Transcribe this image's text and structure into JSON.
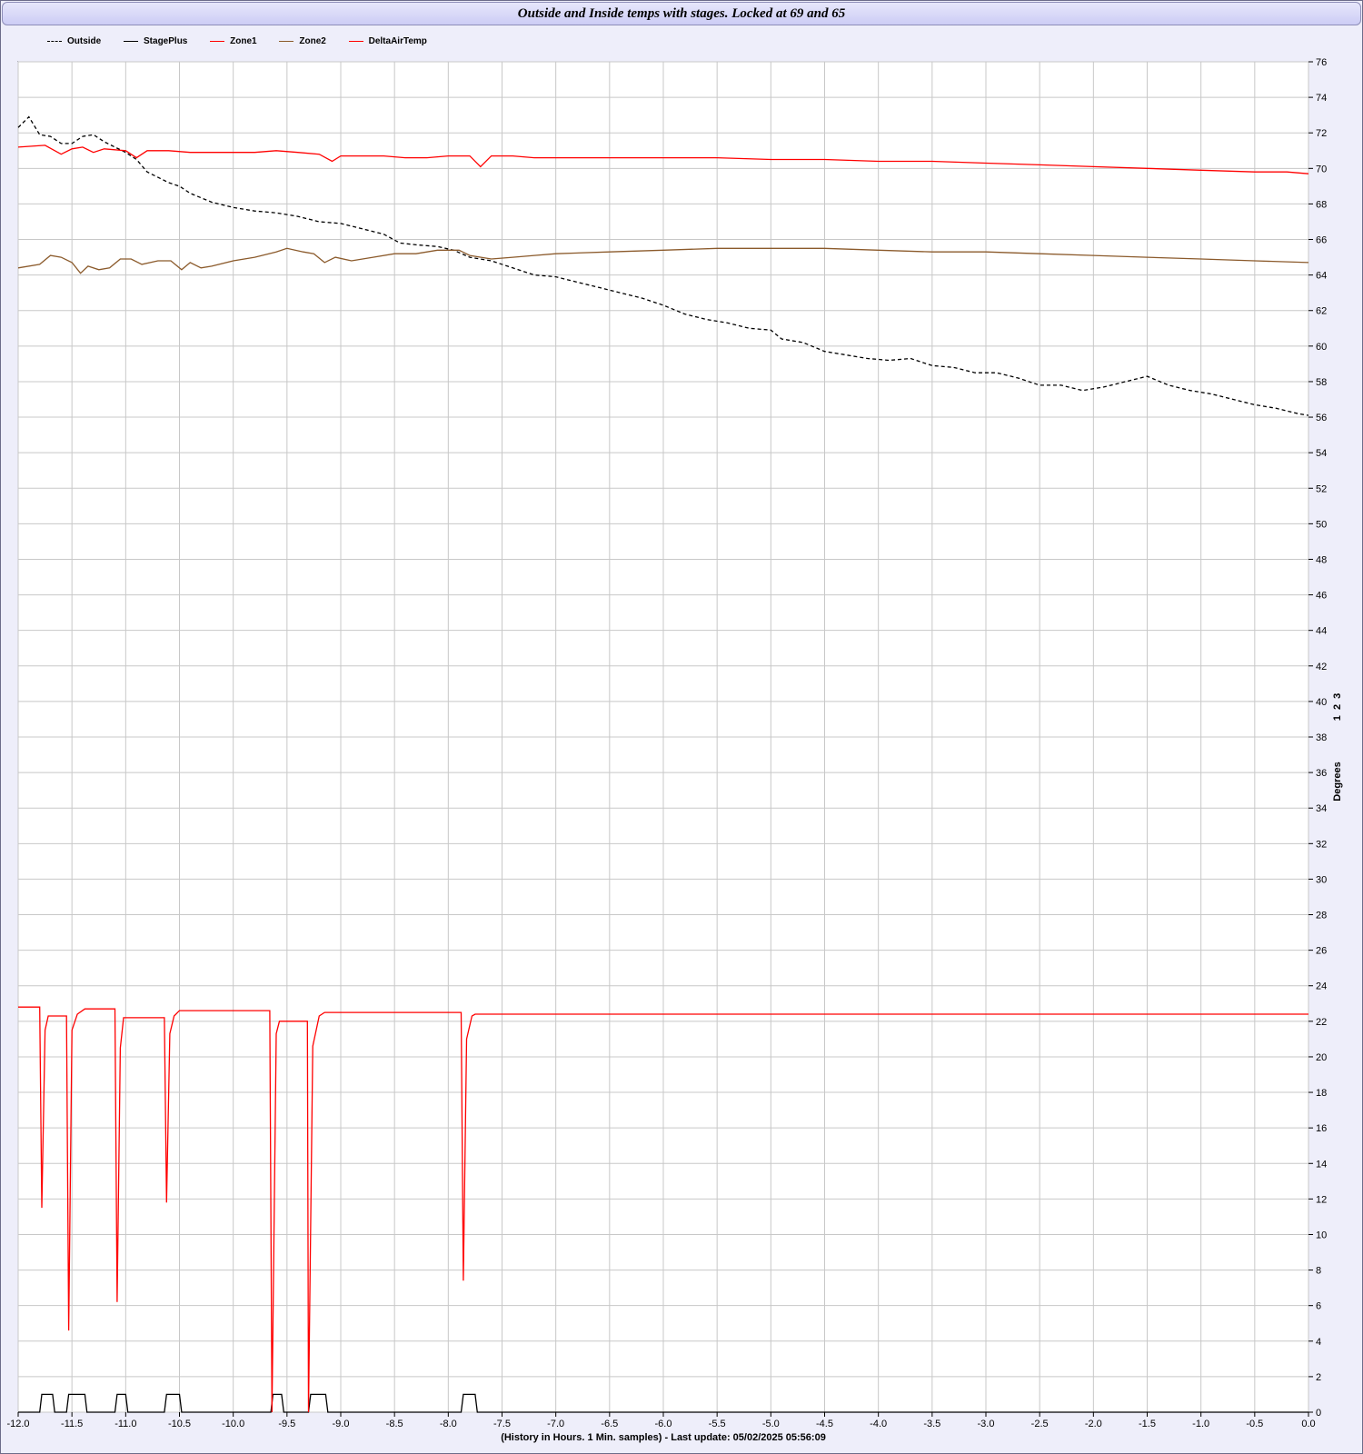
{
  "chart_data": {
    "type": "line",
    "title": "Outside and Inside temps with stages. Locked at 69 and 65",
    "xlabel": "(History in Hours. 1 Min. samples) - Last update: 05/02/2025 05:56:09",
    "ylabel": "Degrees",
    "ylabel_extra": "1  2  3",
    "xlim": [
      -12.0,
      0.0
    ],
    "ylim": [
      0,
      76
    ],
    "x_ticks": [
      -12.0,
      -11.5,
      -11.0,
      -10.5,
      -10.0,
      -9.5,
      -9.0,
      -8.5,
      -8.0,
      -7.5,
      -7.0,
      -6.5,
      -6.0,
      -5.5,
      -5.0,
      -4.5,
      -4.0,
      -3.5,
      -3.0,
      -2.5,
      -2.0,
      -1.5,
      -1.0,
      -0.5,
      0.0
    ],
    "y_ticks": [
      0,
      2,
      4,
      6,
      8,
      10,
      12,
      14,
      16,
      18,
      20,
      22,
      24,
      26,
      28,
      30,
      32,
      34,
      36,
      38,
      40,
      42,
      44,
      46,
      48,
      50,
      52,
      54,
      56,
      58,
      60,
      62,
      64,
      66,
      68,
      70,
      72,
      74,
      76
    ],
    "grid": true,
    "legend_position": "top-left",
    "series": [
      {
        "name": "Outside",
        "color": "#000000",
        "dash": true,
        "points": [
          [
            -12.0,
            72.3
          ],
          [
            -11.9,
            72.9
          ],
          [
            -11.8,
            71.9
          ],
          [
            -11.7,
            71.8
          ],
          [
            -11.6,
            71.4
          ],
          [
            -11.5,
            71.4
          ],
          [
            -11.4,
            71.8
          ],
          [
            -11.3,
            71.9
          ],
          [
            -11.2,
            71.5
          ],
          [
            -11.1,
            71.2
          ],
          [
            -11.0,
            70.9
          ],
          [
            -10.9,
            70.5
          ],
          [
            -10.8,
            69.8
          ],
          [
            -10.7,
            69.5
          ],
          [
            -10.6,
            69.2
          ],
          [
            -10.5,
            69.0
          ],
          [
            -10.4,
            68.6
          ],
          [
            -10.2,
            68.1
          ],
          [
            -10.0,
            67.8
          ],
          [
            -9.8,
            67.6
          ],
          [
            -9.6,
            67.5
          ],
          [
            -9.4,
            67.3
          ],
          [
            -9.2,
            67.0
          ],
          [
            -9.0,
            66.9
          ],
          [
            -8.8,
            66.6
          ],
          [
            -8.6,
            66.3
          ],
          [
            -8.45,
            65.8
          ],
          [
            -8.3,
            65.7
          ],
          [
            -8.1,
            65.6
          ],
          [
            -7.95,
            65.4
          ],
          [
            -7.8,
            65.0
          ],
          [
            -7.6,
            64.8
          ],
          [
            -7.4,
            64.4
          ],
          [
            -7.2,
            64.0
          ],
          [
            -7.0,
            63.9
          ],
          [
            -6.8,
            63.6
          ],
          [
            -6.6,
            63.3
          ],
          [
            -6.4,
            63.0
          ],
          [
            -6.2,
            62.7
          ],
          [
            -6.0,
            62.3
          ],
          [
            -5.8,
            61.8
          ],
          [
            -5.6,
            61.5
          ],
          [
            -5.4,
            61.3
          ],
          [
            -5.2,
            61.0
          ],
          [
            -5.0,
            60.9
          ],
          [
            -4.9,
            60.4
          ],
          [
            -4.7,
            60.2
          ],
          [
            -4.5,
            59.7
          ],
          [
            -4.3,
            59.5
          ],
          [
            -4.1,
            59.3
          ],
          [
            -3.9,
            59.2
          ],
          [
            -3.7,
            59.3
          ],
          [
            -3.5,
            58.9
          ],
          [
            -3.3,
            58.8
          ],
          [
            -3.1,
            58.5
          ],
          [
            -2.9,
            58.5
          ],
          [
            -2.7,
            58.2
          ],
          [
            -2.5,
            57.8
          ],
          [
            -2.3,
            57.8
          ],
          [
            -2.1,
            57.5
          ],
          [
            -1.9,
            57.7
          ],
          [
            -1.7,
            58.0
          ],
          [
            -1.5,
            58.3
          ],
          [
            -1.3,
            57.8
          ],
          [
            -1.1,
            57.5
          ],
          [
            -0.9,
            57.3
          ],
          [
            -0.7,
            57.0
          ],
          [
            -0.5,
            56.7
          ],
          [
            -0.3,
            56.5
          ],
          [
            -0.1,
            56.2
          ],
          [
            0.0,
            56.1
          ]
        ]
      },
      {
        "name": "StagePlus",
        "color": "#000000",
        "dash": false,
        "points": [
          [
            -12.0,
            0
          ],
          [
            -11.8,
            0
          ],
          [
            -11.78,
            1
          ],
          [
            -11.68,
            1
          ],
          [
            -11.66,
            0
          ],
          [
            -11.55,
            0
          ],
          [
            -11.53,
            1
          ],
          [
            -11.38,
            1
          ],
          [
            -11.36,
            0
          ],
          [
            -11.1,
            0
          ],
          [
            -11.08,
            1
          ],
          [
            -11.0,
            1
          ],
          [
            -10.98,
            0
          ],
          [
            -10.64,
            0
          ],
          [
            -10.62,
            1
          ],
          [
            -10.5,
            1
          ],
          [
            -10.48,
            0
          ],
          [
            -9.65,
            0
          ],
          [
            -9.63,
            1
          ],
          [
            -9.55,
            1
          ],
          [
            -9.53,
            0
          ],
          [
            -9.3,
            0
          ],
          [
            -9.28,
            1
          ],
          [
            -9.14,
            1
          ],
          [
            -9.12,
            0
          ],
          [
            -7.88,
            0
          ],
          [
            -7.86,
            1
          ],
          [
            -7.75,
            1
          ],
          [
            -7.73,
            0
          ],
          [
            0.0,
            0
          ]
        ]
      },
      {
        "name": "Zone1",
        "color": "#ff0000",
        "dash": false,
        "points": [
          [
            -12.0,
            71.2
          ],
          [
            -11.75,
            71.3
          ],
          [
            -11.6,
            70.8
          ],
          [
            -11.5,
            71.1
          ],
          [
            -11.4,
            71.2
          ],
          [
            -11.3,
            70.9
          ],
          [
            -11.2,
            71.1
          ],
          [
            -11.0,
            71.0
          ],
          [
            -10.9,
            70.6
          ],
          [
            -10.8,
            71.0
          ],
          [
            -10.6,
            71.0
          ],
          [
            -10.4,
            70.9
          ],
          [
            -10.2,
            70.9
          ],
          [
            -10.0,
            70.9
          ],
          [
            -9.8,
            70.9
          ],
          [
            -9.6,
            71.0
          ],
          [
            -9.4,
            70.9
          ],
          [
            -9.2,
            70.8
          ],
          [
            -9.08,
            70.4
          ],
          [
            -9.0,
            70.7
          ],
          [
            -8.8,
            70.7
          ],
          [
            -8.6,
            70.7
          ],
          [
            -8.4,
            70.6
          ],
          [
            -8.2,
            70.6
          ],
          [
            -8.0,
            70.7
          ],
          [
            -7.8,
            70.7
          ],
          [
            -7.7,
            70.1
          ],
          [
            -7.6,
            70.7
          ],
          [
            -7.4,
            70.7
          ],
          [
            -7.2,
            70.6
          ],
          [
            -7.0,
            70.6
          ],
          [
            -6.5,
            70.6
          ],
          [
            -6.0,
            70.6
          ],
          [
            -5.5,
            70.6
          ],
          [
            -5.0,
            70.5
          ],
          [
            -4.5,
            70.5
          ],
          [
            -4.0,
            70.4
          ],
          [
            -3.5,
            70.4
          ],
          [
            -3.0,
            70.3
          ],
          [
            -2.5,
            70.2
          ],
          [
            -2.0,
            70.1
          ],
          [
            -1.5,
            70.0
          ],
          [
            -1.0,
            69.9
          ],
          [
            -0.5,
            69.8
          ],
          [
            -0.2,
            69.8
          ],
          [
            0.0,
            69.7
          ]
        ]
      },
      {
        "name": "Zone2",
        "color": "#8b5a2b",
        "dash": false,
        "points": [
          [
            -12.0,
            64.4
          ],
          [
            -11.8,
            64.6
          ],
          [
            -11.7,
            65.1
          ],
          [
            -11.6,
            65.0
          ],
          [
            -11.5,
            64.7
          ],
          [
            -11.42,
            64.1
          ],
          [
            -11.35,
            64.5
          ],
          [
            -11.25,
            64.3
          ],
          [
            -11.15,
            64.4
          ],
          [
            -11.05,
            64.9
          ],
          [
            -10.95,
            64.9
          ],
          [
            -10.85,
            64.6
          ],
          [
            -10.7,
            64.8
          ],
          [
            -10.58,
            64.8
          ],
          [
            -10.48,
            64.3
          ],
          [
            -10.4,
            64.7
          ],
          [
            -10.3,
            64.4
          ],
          [
            -10.2,
            64.5
          ],
          [
            -10.0,
            64.8
          ],
          [
            -9.8,
            65.0
          ],
          [
            -9.6,
            65.3
          ],
          [
            -9.5,
            65.5
          ],
          [
            -9.35,
            65.3
          ],
          [
            -9.25,
            65.2
          ],
          [
            -9.15,
            64.7
          ],
          [
            -9.05,
            65.0
          ],
          [
            -8.9,
            64.8
          ],
          [
            -8.7,
            65.0
          ],
          [
            -8.5,
            65.2
          ],
          [
            -8.3,
            65.2
          ],
          [
            -8.1,
            65.4
          ],
          [
            -7.9,
            65.4
          ],
          [
            -7.8,
            65.1
          ],
          [
            -7.6,
            64.9
          ],
          [
            -7.4,
            65.0
          ],
          [
            -7.2,
            65.1
          ],
          [
            -7.0,
            65.2
          ],
          [
            -6.5,
            65.3
          ],
          [
            -6.0,
            65.4
          ],
          [
            -5.5,
            65.5
          ],
          [
            -5.0,
            65.5
          ],
          [
            -4.5,
            65.5
          ],
          [
            -4.0,
            65.4
          ],
          [
            -3.5,
            65.3
          ],
          [
            -3.0,
            65.3
          ],
          [
            -2.5,
            65.2
          ],
          [
            -2.0,
            65.1
          ],
          [
            -1.5,
            65.0
          ],
          [
            -1.0,
            64.9
          ],
          [
            -0.5,
            64.8
          ],
          [
            0.0,
            64.7
          ]
        ]
      },
      {
        "name": "DeltaAirTemp",
        "color": "#ff0000",
        "dash": false,
        "points": [
          [
            -12.0,
            22.8
          ],
          [
            -11.8,
            22.8
          ],
          [
            -11.78,
            11.5
          ],
          [
            -11.75,
            21.5
          ],
          [
            -11.72,
            22.3
          ],
          [
            -11.55,
            22.3
          ],
          [
            -11.53,
            4.6
          ],
          [
            -11.5,
            21.5
          ],
          [
            -11.45,
            22.4
          ],
          [
            -11.38,
            22.7
          ],
          [
            -11.1,
            22.7
          ],
          [
            -11.08,
            6.2
          ],
          [
            -11.05,
            20.5
          ],
          [
            -11.02,
            22.2
          ],
          [
            -10.64,
            22.2
          ],
          [
            -10.62,
            11.8
          ],
          [
            -10.59,
            21.3
          ],
          [
            -10.55,
            22.3
          ],
          [
            -10.5,
            22.6
          ],
          [
            -9.66,
            22.6
          ],
          [
            -9.64,
            0
          ],
          [
            -9.6,
            21.3
          ],
          [
            -9.57,
            22.0
          ],
          [
            -9.31,
            22.0
          ],
          [
            -9.3,
            0
          ],
          [
            -9.26,
            20.6
          ],
          [
            -9.2,
            22.3
          ],
          [
            -9.15,
            22.5
          ],
          [
            -7.88,
            22.5
          ],
          [
            -7.86,
            7.4
          ],
          [
            -7.83,
            21.0
          ],
          [
            -7.78,
            22.3
          ],
          [
            -7.75,
            22.4
          ],
          [
            0.0,
            22.4
          ]
        ]
      }
    ]
  }
}
